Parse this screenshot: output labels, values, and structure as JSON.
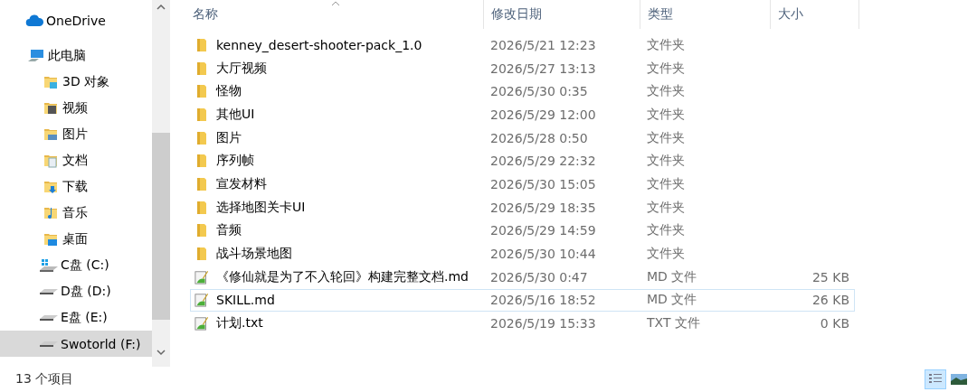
{
  "nav_pane": {
    "items": [
      {
        "label": "OneDrive",
        "kind": "onedrive",
        "selected": false
      },
      {
        "label": "此电脑",
        "kind": "pc",
        "selected": false,
        "children": [
          {
            "label": "3D 对象",
            "kind": "folder-3d",
            "selected": false
          },
          {
            "label": "视频",
            "kind": "video",
            "selected": false
          },
          {
            "label": "图片",
            "kind": "pictures",
            "selected": false
          },
          {
            "label": "文档",
            "kind": "documents",
            "selected": false
          },
          {
            "label": "下载",
            "kind": "downloads",
            "selected": false
          },
          {
            "label": "音乐",
            "kind": "music",
            "selected": false
          },
          {
            "label": "桌面",
            "kind": "desktop",
            "selected": false
          },
          {
            "label": "C盘 (C:)",
            "kind": "system-drive",
            "selected": false
          },
          {
            "label": "D盘 (D:)",
            "kind": "drive",
            "selected": false
          },
          {
            "label": "E盘 (E:)",
            "kind": "drive",
            "selected": false
          },
          {
            "label": "Swotorld (F:)",
            "kind": "drive",
            "selected": true
          }
        ]
      }
    ]
  },
  "file_list": {
    "columns": [
      "名称",
      "修改日期",
      "类型",
      "大小"
    ],
    "rows": [
      {
        "name": "kenney_desert-shooter-pack_1.0",
        "date": "2026/5/21 12:23",
        "type": "文件夹",
        "kind": "folder",
        "focused": false
      },
      {
        "name": "大厅视频",
        "date": "2026/5/27 13:13",
        "type": "文件夹",
        "kind": "folder",
        "focused": false
      },
      {
        "name": "怪物",
        "date": "2026/5/30 0:35",
        "type": "文件夹",
        "kind": "folder",
        "focused": false
      },
      {
        "name": "其他UI",
        "date": "2026/5/29 12:00",
        "type": "文件夹",
        "kind": "folder",
        "focused": false
      },
      {
        "name": "图片",
        "date": "2026/5/28 0:50",
        "type": "文件夹",
        "kind": "folder",
        "focused": false
      },
      {
        "name": "序列帧",
        "date": "2026/5/29 22:32",
        "type": "文件夹",
        "kind": "folder",
        "focused": false
      },
      {
        "name": "宣发材料",
        "date": "2026/5/30 15:05",
        "type": "文件夹",
        "kind": "folder",
        "focused": false
      },
      {
        "name": "选择地图关卡UI",
        "date": "2026/5/29 18:35",
        "type": "文件夹",
        "kind": "folder",
        "focused": false
      },
      {
        "name": "音频",
        "date": "2026/5/29 14:59",
        "type": "文件夹",
        "kind": "folder",
        "focused": false
      },
      {
        "name": "战斗场景地图",
        "date": "2026/5/30 10:44",
        "type": "文件夹",
        "kind": "folder",
        "focused": false
      },
      {
        "name": "《修仙就是为了不入轮回》构建完整文档.md",
        "date": "2026/5/30 0:47",
        "type": "MD 文件",
        "size": "25 KB",
        "kind": "document",
        "focused": false
      },
      {
        "name": "SKILL.md",
        "date": "2026/5/16 18:52",
        "type": "MD 文件",
        "size": "26 KB",
        "kind": "document",
        "focused": true
      },
      {
        "name": "计划.txt",
        "date": "2026/5/19 15:33",
        "type": "TXT 文件",
        "size": "0 KB",
        "kind": "document",
        "focused": false
      }
    ]
  },
  "status_bar": {
    "item_count": "13 个项目",
    "views": [
      {
        "kind": "details",
        "selected": true
      },
      {
        "kind": "large-icons",
        "selected": false
      }
    ]
  }
}
